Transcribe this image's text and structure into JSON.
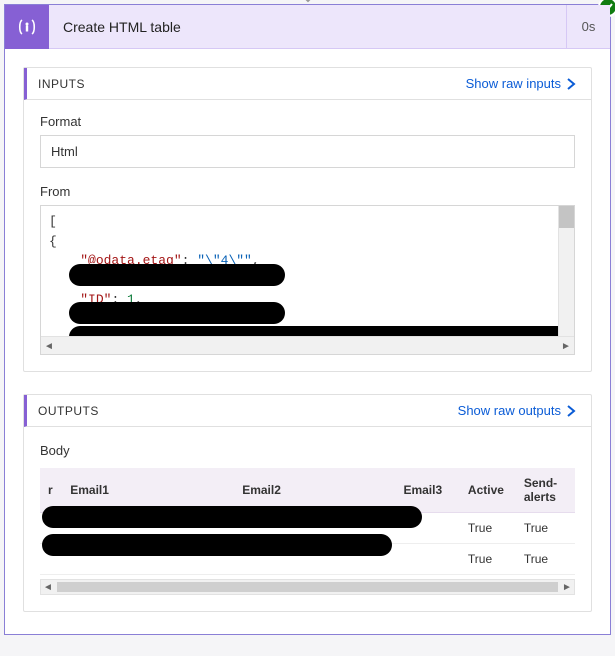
{
  "header": {
    "title": "Create HTML table",
    "duration": "0s",
    "status": "success"
  },
  "inputs": {
    "section_label": "INPUTS",
    "raw_link": "Show raw inputs",
    "format_label": "Format",
    "format_value": "Html",
    "from_label": "From",
    "from_json": {
      "line1": "[",
      "line2": "  {",
      "line3_key": "\"@odata.etag\"",
      "line3_sep": ": ",
      "line3_val": "\"\\\"4\\\"\"",
      "line3_comma": ",",
      "line5_key": "\"ID\"",
      "line5_sep": ": ",
      "line5_val": "1",
      "line5_comma": ","
    }
  },
  "outputs": {
    "section_label": "OUTPUTS",
    "raw_link": "Show raw outputs",
    "body_label": "Body",
    "columns": {
      "c0": "r",
      "c1": "Email1",
      "c2": "Email2",
      "c3": "Email3",
      "c4": "Active",
      "c5": "Send-alerts"
    },
    "rows": [
      {
        "active": "True",
        "sendalerts": "True"
      },
      {
        "active": "True",
        "sendalerts": "True"
      }
    ]
  }
}
